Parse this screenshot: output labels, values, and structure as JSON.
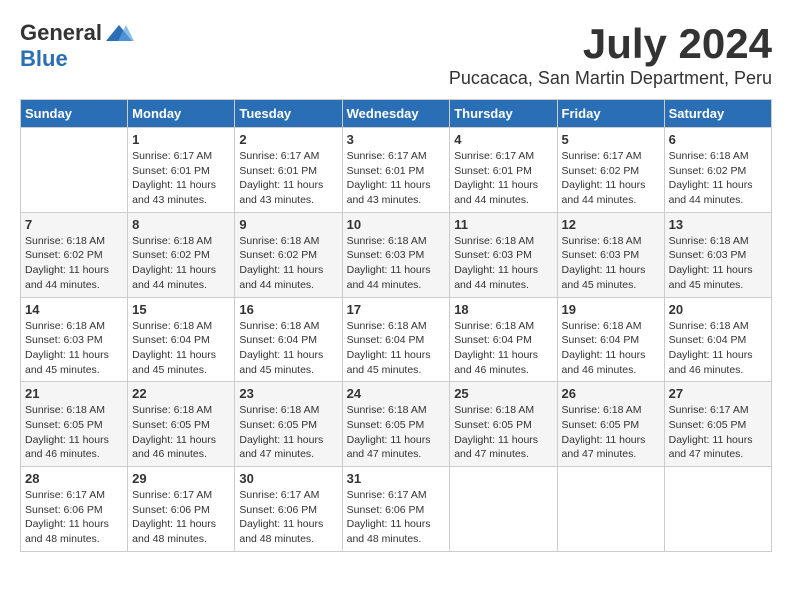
{
  "logo": {
    "general": "General",
    "blue": "Blue"
  },
  "title": {
    "month": "July 2024",
    "location": "Pucacaca, San Martin Department, Peru"
  },
  "headers": [
    "Sunday",
    "Monday",
    "Tuesday",
    "Wednesday",
    "Thursday",
    "Friday",
    "Saturday"
  ],
  "weeks": [
    [
      {
        "day": "",
        "info": ""
      },
      {
        "day": "1",
        "info": "Sunrise: 6:17 AM\nSunset: 6:01 PM\nDaylight: 11 hours\nand 43 minutes."
      },
      {
        "day": "2",
        "info": "Sunrise: 6:17 AM\nSunset: 6:01 PM\nDaylight: 11 hours\nand 43 minutes."
      },
      {
        "day": "3",
        "info": "Sunrise: 6:17 AM\nSunset: 6:01 PM\nDaylight: 11 hours\nand 43 minutes."
      },
      {
        "day": "4",
        "info": "Sunrise: 6:17 AM\nSunset: 6:01 PM\nDaylight: 11 hours\nand 44 minutes."
      },
      {
        "day": "5",
        "info": "Sunrise: 6:17 AM\nSunset: 6:02 PM\nDaylight: 11 hours\nand 44 minutes."
      },
      {
        "day": "6",
        "info": "Sunrise: 6:18 AM\nSunset: 6:02 PM\nDaylight: 11 hours\nand 44 minutes."
      }
    ],
    [
      {
        "day": "7",
        "info": "Sunrise: 6:18 AM\nSunset: 6:02 PM\nDaylight: 11 hours\nand 44 minutes."
      },
      {
        "day": "8",
        "info": "Sunrise: 6:18 AM\nSunset: 6:02 PM\nDaylight: 11 hours\nand 44 minutes."
      },
      {
        "day": "9",
        "info": "Sunrise: 6:18 AM\nSunset: 6:02 PM\nDaylight: 11 hours\nand 44 minutes."
      },
      {
        "day": "10",
        "info": "Sunrise: 6:18 AM\nSunset: 6:03 PM\nDaylight: 11 hours\nand 44 minutes."
      },
      {
        "day": "11",
        "info": "Sunrise: 6:18 AM\nSunset: 6:03 PM\nDaylight: 11 hours\nand 44 minutes."
      },
      {
        "day": "12",
        "info": "Sunrise: 6:18 AM\nSunset: 6:03 PM\nDaylight: 11 hours\nand 45 minutes."
      },
      {
        "day": "13",
        "info": "Sunrise: 6:18 AM\nSunset: 6:03 PM\nDaylight: 11 hours\nand 45 minutes."
      }
    ],
    [
      {
        "day": "14",
        "info": "Sunrise: 6:18 AM\nSunset: 6:03 PM\nDaylight: 11 hours\nand 45 minutes."
      },
      {
        "day": "15",
        "info": "Sunrise: 6:18 AM\nSunset: 6:04 PM\nDaylight: 11 hours\nand 45 minutes."
      },
      {
        "day": "16",
        "info": "Sunrise: 6:18 AM\nSunset: 6:04 PM\nDaylight: 11 hours\nand 45 minutes."
      },
      {
        "day": "17",
        "info": "Sunrise: 6:18 AM\nSunset: 6:04 PM\nDaylight: 11 hours\nand 45 minutes."
      },
      {
        "day": "18",
        "info": "Sunrise: 6:18 AM\nSunset: 6:04 PM\nDaylight: 11 hours\nand 46 minutes."
      },
      {
        "day": "19",
        "info": "Sunrise: 6:18 AM\nSunset: 6:04 PM\nDaylight: 11 hours\nand 46 minutes."
      },
      {
        "day": "20",
        "info": "Sunrise: 6:18 AM\nSunset: 6:04 PM\nDaylight: 11 hours\nand 46 minutes."
      }
    ],
    [
      {
        "day": "21",
        "info": "Sunrise: 6:18 AM\nSunset: 6:05 PM\nDaylight: 11 hours\nand 46 minutes."
      },
      {
        "day": "22",
        "info": "Sunrise: 6:18 AM\nSunset: 6:05 PM\nDaylight: 11 hours\nand 46 minutes."
      },
      {
        "day": "23",
        "info": "Sunrise: 6:18 AM\nSunset: 6:05 PM\nDaylight: 11 hours\nand 47 minutes."
      },
      {
        "day": "24",
        "info": "Sunrise: 6:18 AM\nSunset: 6:05 PM\nDaylight: 11 hours\nand 47 minutes."
      },
      {
        "day": "25",
        "info": "Sunrise: 6:18 AM\nSunset: 6:05 PM\nDaylight: 11 hours\nand 47 minutes."
      },
      {
        "day": "26",
        "info": "Sunrise: 6:18 AM\nSunset: 6:05 PM\nDaylight: 11 hours\nand 47 minutes."
      },
      {
        "day": "27",
        "info": "Sunrise: 6:17 AM\nSunset: 6:05 PM\nDaylight: 11 hours\nand 47 minutes."
      }
    ],
    [
      {
        "day": "28",
        "info": "Sunrise: 6:17 AM\nSunset: 6:06 PM\nDaylight: 11 hours\nand 48 minutes."
      },
      {
        "day": "29",
        "info": "Sunrise: 6:17 AM\nSunset: 6:06 PM\nDaylight: 11 hours\nand 48 minutes."
      },
      {
        "day": "30",
        "info": "Sunrise: 6:17 AM\nSunset: 6:06 PM\nDaylight: 11 hours\nand 48 minutes."
      },
      {
        "day": "31",
        "info": "Sunrise: 6:17 AM\nSunset: 6:06 PM\nDaylight: 11 hours\nand 48 minutes."
      },
      {
        "day": "",
        "info": ""
      },
      {
        "day": "",
        "info": ""
      },
      {
        "day": "",
        "info": ""
      }
    ]
  ]
}
